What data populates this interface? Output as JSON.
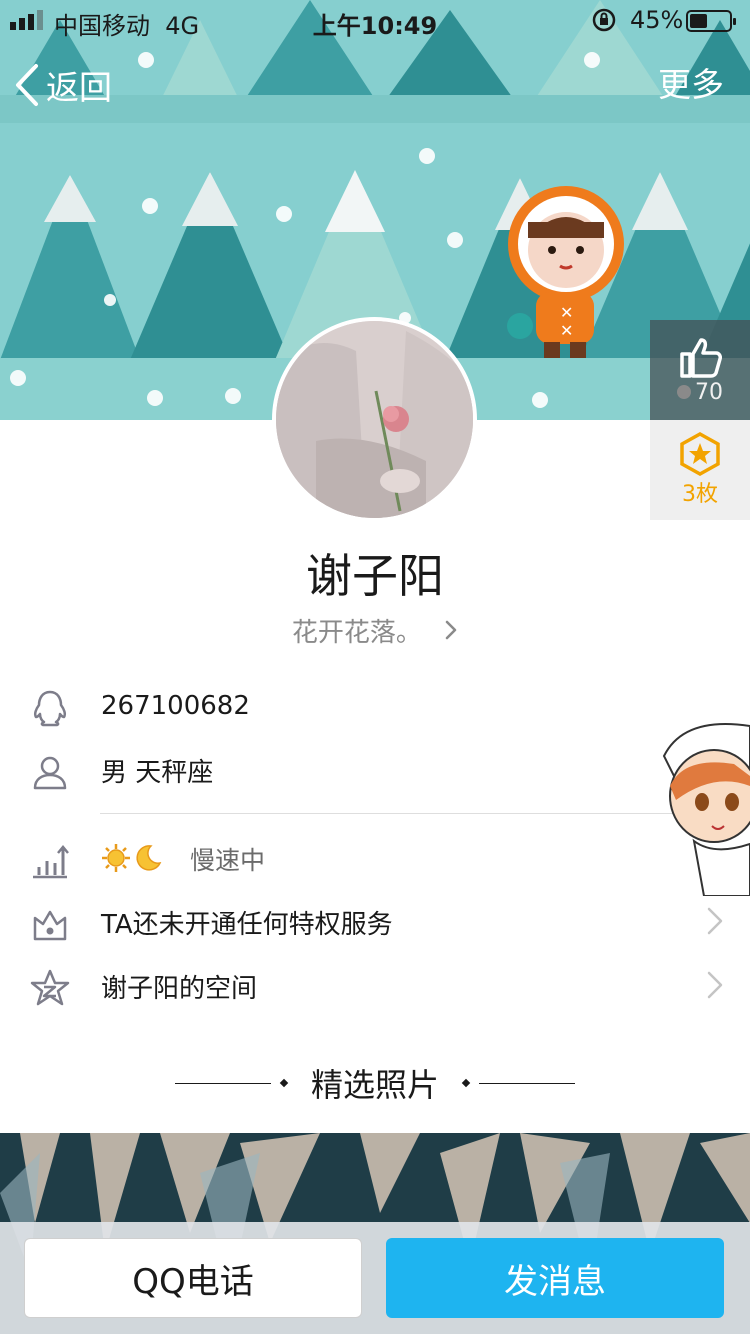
{
  "status_bar": {
    "carrier": "中国移动",
    "network": "4G",
    "time": "上午10:49",
    "battery_percent": "45%",
    "battery_level": 0.45
  },
  "nav": {
    "back_label": "返回",
    "more_label": "更多"
  },
  "side_panel": {
    "like_count": "70",
    "medal_count": "3枚"
  },
  "profile": {
    "name": "谢子阳",
    "signature": "花开花落。"
  },
  "info": {
    "qq_number": "267100682",
    "gender_zodiac": "男 天秤座",
    "level_status": "慢速中",
    "privilege": "TA还未开通任何特权服务",
    "space": "谢子阳的空间"
  },
  "section": {
    "photos_title": "精选照片"
  },
  "actions": {
    "call_label": "QQ电话",
    "message_label": "发消息"
  },
  "colors": {
    "banner_bg": "#86cfcf",
    "tree_dark": "#2f8f93",
    "tree_mid": "#3e9fa3",
    "tree_light": "#9ed8d2",
    "message_button": "#1eb4f0",
    "medal": "#f2a300"
  },
  "icons": {
    "back": "chevron-left-icon",
    "like": "thumbs-up-icon",
    "medal": "star-hexagon-icon",
    "qq": "penguin-icon",
    "person": "person-icon",
    "level": "bar-chart-up-icon",
    "privilege": "crown-icon",
    "space": "star-z-icon",
    "chevron": "chevron-right-icon"
  }
}
